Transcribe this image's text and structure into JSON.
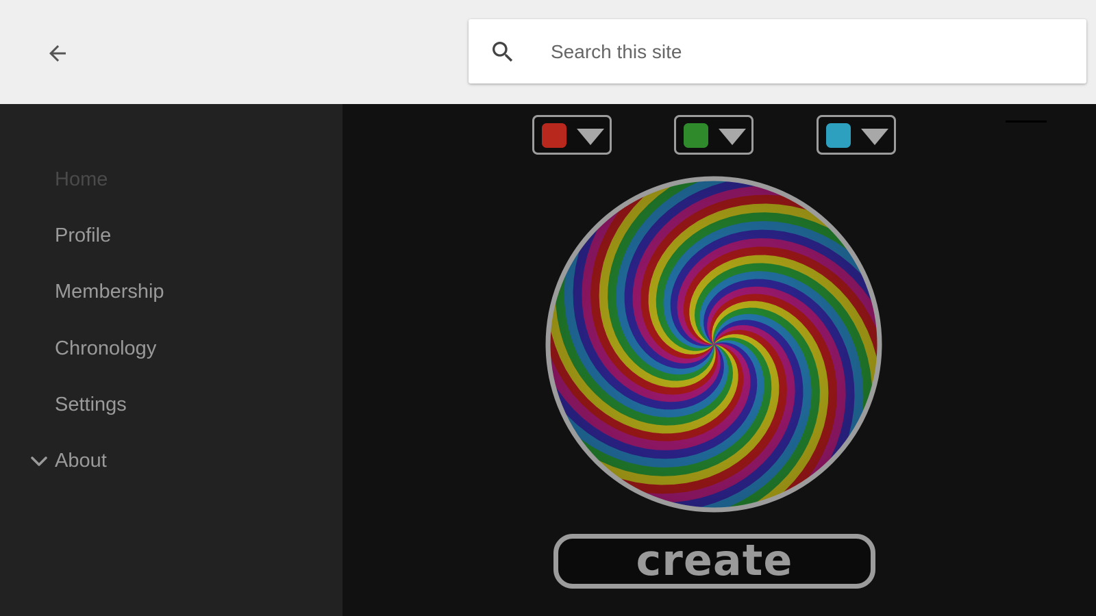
{
  "header": {
    "back_icon": "arrow-left-icon",
    "search": {
      "icon": "search-icon",
      "placeholder": "Search this site",
      "value": ""
    }
  },
  "sidebar": {
    "items": [
      {
        "label": "Home",
        "active": true
      },
      {
        "label": "Profile",
        "active": false
      },
      {
        "label": "Membership",
        "active": false
      },
      {
        "label": "Chronology",
        "active": false
      },
      {
        "label": "Settings",
        "active": false
      },
      {
        "label": "About",
        "active": false,
        "expandable": true,
        "icon": "chevron-down-icon"
      }
    ]
  },
  "main": {
    "color_selectors": [
      {
        "color": "#b8281c",
        "icon": "triangle-down-icon"
      },
      {
        "color": "#2f8a2c",
        "icon": "triangle-down-icon"
      },
      {
        "color": "#2d9fbf",
        "icon": "triangle-down-icon"
      }
    ],
    "spiral": {
      "colors": [
        "#cc1f1f",
        "#e0d41e",
        "#2ca53a",
        "#2b8fcf",
        "#3a2fb8",
        "#c41f8a"
      ],
      "arms": 12
    },
    "create_label": "create"
  },
  "theme": {
    "header_bg": "#efefef",
    "sidebar_bg": "#222222",
    "main_bg": "#111111",
    "outline": "#9c9c9c"
  }
}
